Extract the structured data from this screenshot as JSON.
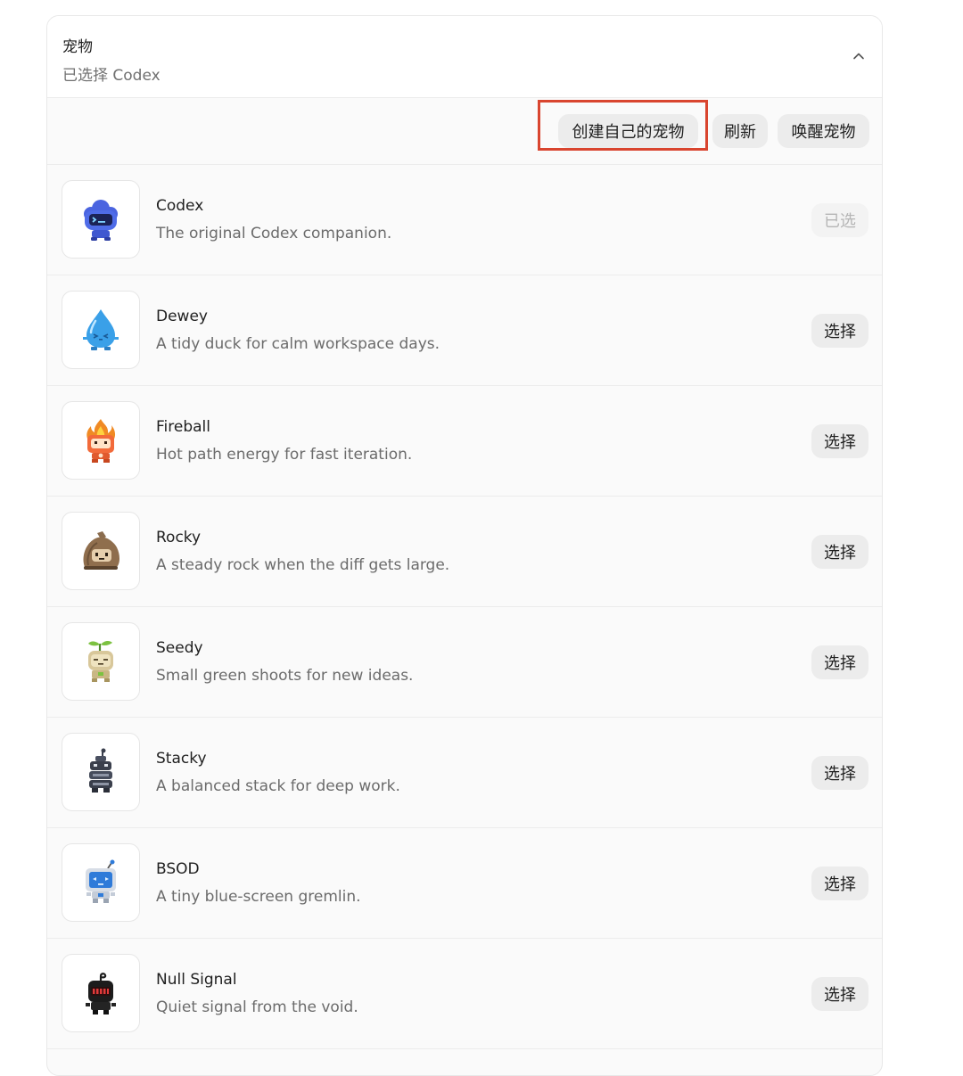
{
  "section": {
    "title": "宠物",
    "subtitle": "已选择 Codex"
  },
  "toolbar": {
    "create_label": "创建自己的宠物",
    "refresh_label": "刷新",
    "wake_label": "唤醒宠物"
  },
  "pets": [
    {
      "name": "Codex",
      "description": "The original Codex companion.",
      "action": "已选"
    },
    {
      "name": "Dewey",
      "description": "A tidy duck for calm workspace days.",
      "action": "选择"
    },
    {
      "name": "Fireball",
      "description": "Hot path energy for fast iteration.",
      "action": "选择"
    },
    {
      "name": "Rocky",
      "description": "A steady rock when the diff gets large.",
      "action": "选择"
    },
    {
      "name": "Seedy",
      "description": "Small green shoots for new ideas.",
      "action": "选择"
    },
    {
      "name": "Stacky",
      "description": "A balanced stack for deep work.",
      "action": "选择"
    },
    {
      "name": "BSOD",
      "description": "A tiny blue-screen gremlin.",
      "action": "选择"
    },
    {
      "name": "Null Signal",
      "description": "Quiet signal from the void.",
      "action": "选择"
    }
  ],
  "pet_icons": [
    "codex-robot-icon",
    "dewey-water-drop-icon",
    "fireball-flame-icon",
    "rocky-rock-icon",
    "seedy-sprout-icon",
    "stacky-stack-icon",
    "bsod-monitor-robot-icon",
    "null-signal-icon"
  ],
  "colors": {
    "highlight_border": "#d9452f",
    "button_bg": "#ececec",
    "selected_text": "#b5b5b5"
  }
}
